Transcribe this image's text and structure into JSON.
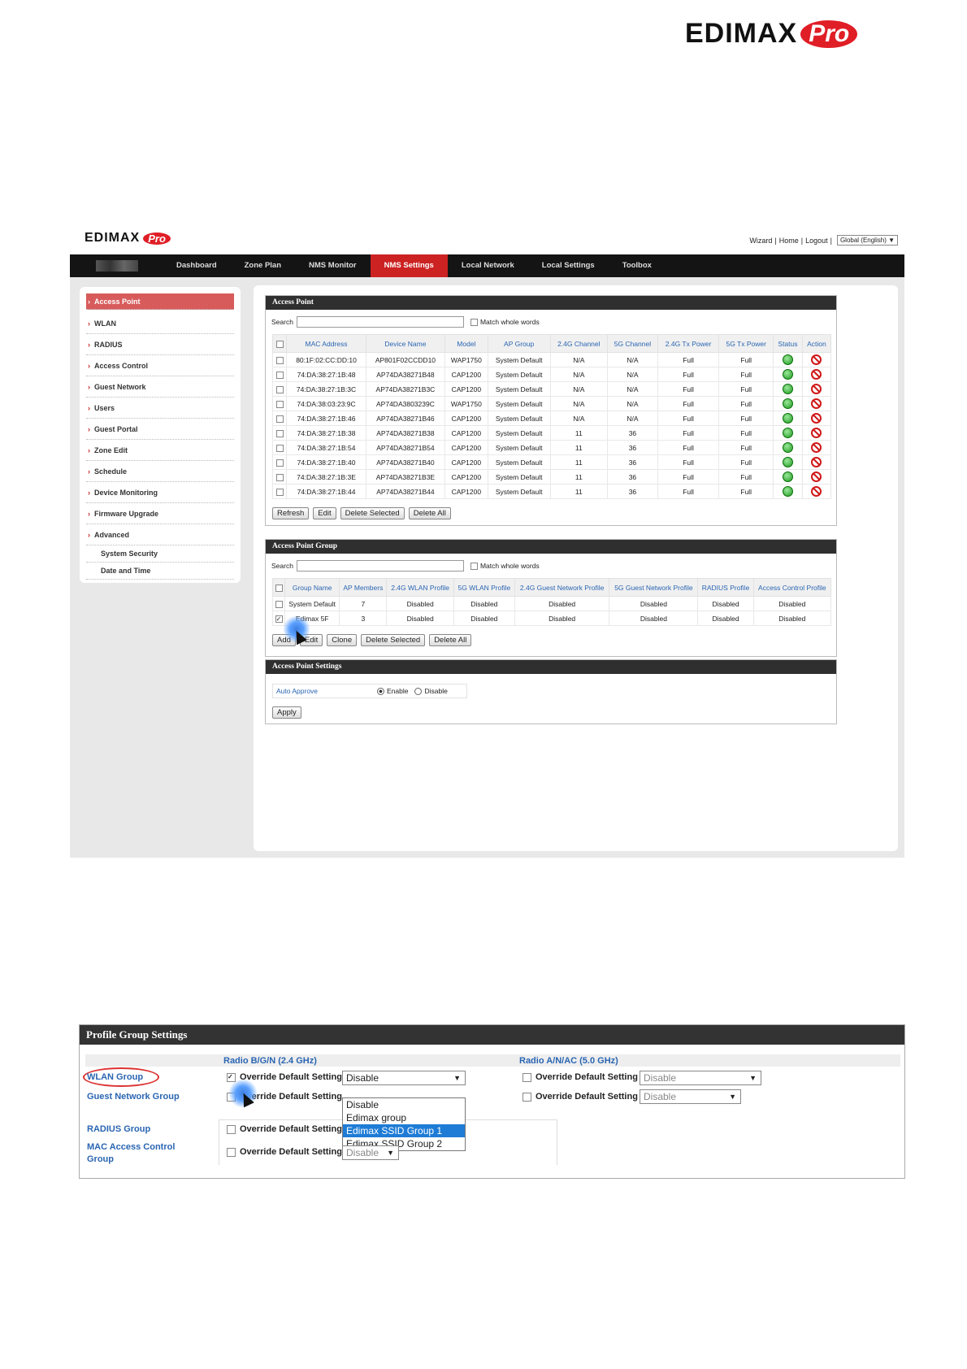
{
  "brand": {
    "name": "EDIMAX",
    "pro": "Pro"
  },
  "top_links": {
    "wizard": "Wizard",
    "home": "Home",
    "logout": "Logout",
    "sep": "|",
    "language": "Global (English)"
  },
  "nav": [
    "Dashboard",
    "Zone Plan",
    "NMS Monitor",
    "NMS Settings",
    "Local Network",
    "Local Settings",
    "Toolbox"
  ],
  "nav_active": "NMS Settings",
  "sidebar": [
    "Access Point",
    "WLAN",
    "RADIUS",
    "Access Control",
    "Guest Network",
    "Users",
    "Guest Portal",
    "Zone Edit",
    "Schedule",
    "Device Monitoring",
    "Firmware Upgrade",
    "Advanced"
  ],
  "sidebar_sub": [
    "System Security",
    "Date and Time"
  ],
  "ap_panel": {
    "title": "Access Point",
    "search_label": "Search",
    "match": "Match whole words",
    "columns": [
      "MAC Address",
      "Device Name",
      "Model",
      "AP Group",
      "2.4G Channel",
      "5G Channel",
      "2.4G Tx Power",
      "5G Tx Power",
      "Status",
      "Action"
    ],
    "rows": [
      [
        "80:1F:02:CC:DD:10",
        "AP801F02CCDD10",
        "WAP1750",
        "System Default",
        "N/A",
        "N/A",
        "Full",
        "Full"
      ],
      [
        "74:DA:38:27:1B:48",
        "AP74DA38271B48",
        "CAP1200",
        "System Default",
        "N/A",
        "N/A",
        "Full",
        "Full"
      ],
      [
        "74:DA:38:27:1B:3C",
        "AP74DA38271B3C",
        "CAP1200",
        "System Default",
        "N/A",
        "N/A",
        "Full",
        "Full"
      ],
      [
        "74:DA:38:03:23:9C",
        "AP74DA3803239C",
        "WAP1750",
        "System Default",
        "N/A",
        "N/A",
        "Full",
        "Full"
      ],
      [
        "74:DA:38:27:1B:46",
        "AP74DA38271B46",
        "CAP1200",
        "System Default",
        "N/A",
        "N/A",
        "Full",
        "Full"
      ],
      [
        "74:DA:38:27:1B:38",
        "AP74DA38271B38",
        "CAP1200",
        "System Default",
        "11",
        "36",
        "Full",
        "Full"
      ],
      [
        "74:DA:38:27:1B:54",
        "AP74DA38271B54",
        "CAP1200",
        "System Default",
        "11",
        "36",
        "Full",
        "Full"
      ],
      [
        "74:DA:38:27:1B:40",
        "AP74DA38271B40",
        "CAP1200",
        "System Default",
        "11",
        "36",
        "Full",
        "Full"
      ],
      [
        "74:DA:38:27:1B:3E",
        "AP74DA38271B3E",
        "CAP1200",
        "System Default",
        "11",
        "36",
        "Full",
        "Full"
      ],
      [
        "74:DA:38:27:1B:44",
        "AP74DA38271B44",
        "CAP1200",
        "System Default",
        "11",
        "36",
        "Full",
        "Full"
      ]
    ],
    "buttons": [
      "Refresh",
      "Edit",
      "Delete Selected",
      "Delete All"
    ]
  },
  "apg_panel": {
    "title": "Access Point Group",
    "search_label": "Search",
    "match": "Match whole words",
    "columns": [
      "Group Name",
      "AP Members",
      "2.4G WLAN Profile",
      "5G WLAN Profile",
      "2.4G Guest Network Profile",
      "5G Guest Network Profile",
      "RADIUS Profile",
      "Access Control Profile"
    ],
    "rows": [
      {
        "checked": false,
        "cells": [
          "System Default",
          "7",
          "Disabled",
          "Disabled",
          "Disabled",
          "Disabled",
          "Disabled",
          "Disabled"
        ]
      },
      {
        "checked": true,
        "cells": [
          "Edimax 5F",
          "3",
          "Disabled",
          "Disabled",
          "Disabled",
          "Disabled",
          "Disabled",
          "Disabled"
        ]
      }
    ],
    "buttons": [
      "Add",
      "Edit",
      "Clone",
      "Delete Selected",
      "Delete All"
    ]
  },
  "aps_panel": {
    "title": "Access Point Settings",
    "label": "Auto Approve",
    "enable": "Enable",
    "disable": "Disable",
    "apply": "Apply"
  },
  "profile": {
    "title": "Profile Group Settings",
    "radio24": "Radio B/G/N (2.4 GHz)",
    "radio5": "Radio A/N/AC (5.0 GHz)",
    "rows": [
      "WLAN Group",
      "Guest Network Group",
      "RADIUS Group",
      "MAC Access Control Group"
    ],
    "override": "Override Default Setting",
    "select_value": "Disable",
    "options": [
      "Disable",
      "Edimax group",
      "Edimax SSID Group 1",
      "Edimax SSID Group 2"
    ]
  }
}
